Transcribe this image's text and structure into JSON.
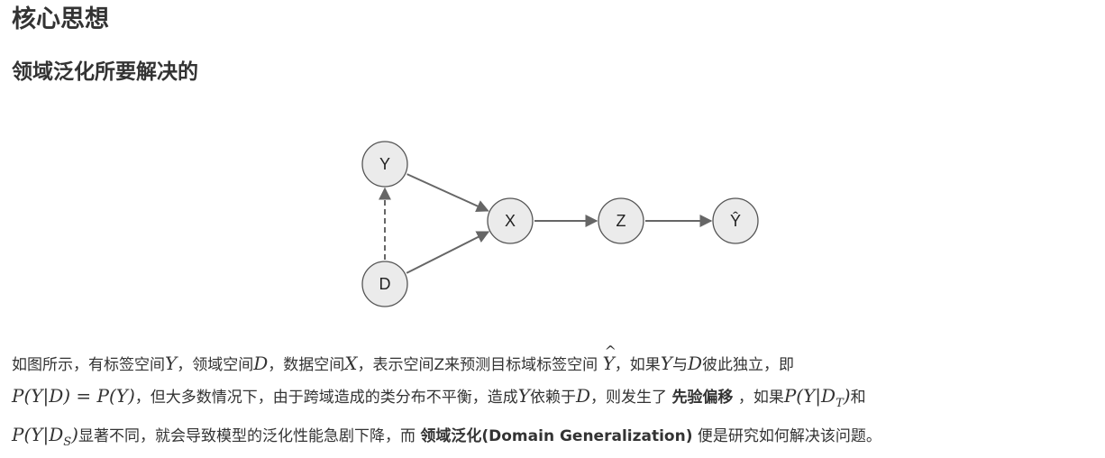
{
  "headings": {
    "title": "核心思想",
    "subtitle": "领域泛化所要解决的"
  },
  "diagram": {
    "nodes": [
      {
        "id": "Y",
        "label": "Y"
      },
      {
        "id": "D",
        "label": "D"
      },
      {
        "id": "X",
        "label": "X"
      },
      {
        "id": "Z",
        "label": "Z"
      },
      {
        "id": "Yhat",
        "label": "Ŷ"
      }
    ],
    "edges": [
      {
        "from": "Y",
        "to": "X",
        "style": "solid"
      },
      {
        "from": "D",
        "to": "X",
        "style": "solid"
      },
      {
        "from": "D",
        "to": "Y",
        "style": "dashed"
      },
      {
        "from": "X",
        "to": "Z",
        "style": "solid"
      },
      {
        "from": "Z",
        "to": "Yhat",
        "style": "solid"
      }
    ],
    "node_fill": "#ebebeb",
    "node_stroke": "#555555",
    "edge_color": "#666666"
  },
  "paragraph": {
    "l1_a": "如图所示，有标签空间",
    "l1_m1": "Y",
    "l1_b": "，领域空间",
    "l1_m2": "D",
    "l1_c": "，数据空间",
    "l1_m3": "X",
    "l1_d": "，表示空间Z来预测目标域标签空间 ",
    "l1_m4": "Y",
    "l1_m4_hat": "^",
    "l1_e": "，如果",
    "l1_m5": "Y",
    "l1_f": "与",
    "l1_m6": "D",
    "l1_g": "彼此独立，即",
    "l2_m1": "P(Y|D) = P(Y)",
    "l2_a": "，但大多数情况下，由于跨域造成的类分布不平衡，造成",
    "l2_m2": "Y",
    "l2_b": "依赖于",
    "l2_m3": "D",
    "l2_c": "，则发生了 ",
    "l2_bold": "先验偏移",
    "l2_d": " ，如果",
    "l2_m4": "P(Y|D",
    "l2_m4_sub": "T",
    "l2_m4_end": ")",
    "l2_e": "和",
    "l3_m1": "P(Y|D",
    "l3_m1_sub": "S",
    "l3_m1_end": ")",
    "l3_a": "显著不同，就会导致模型的泛化性能急剧下降，而 ",
    "l3_bold": "领域泛化(Domain Generalization)",
    "l3_b": " 便是研究如何解决该问题。"
  }
}
